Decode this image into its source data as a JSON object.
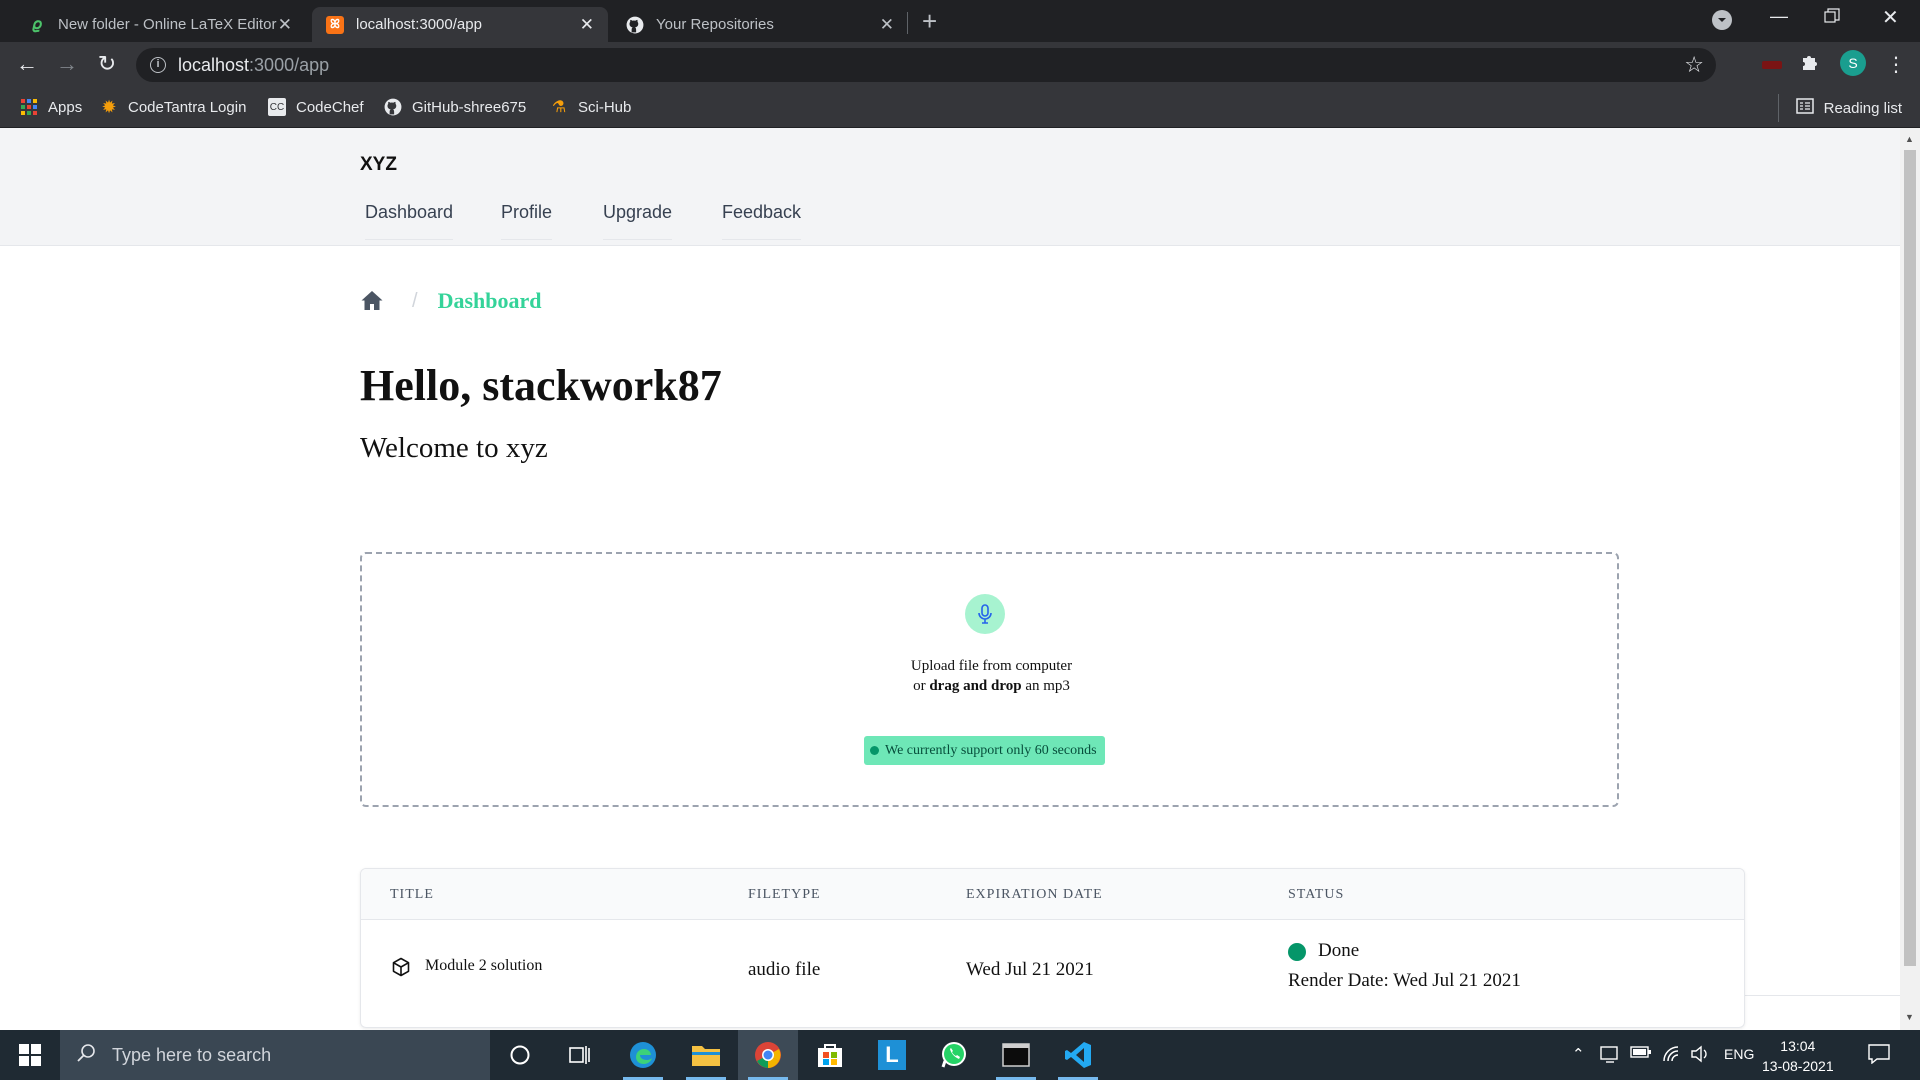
{
  "browser": {
    "tabs": [
      {
        "title": "New folder - Online LaTeX Editor",
        "active": false
      },
      {
        "title": "localhost:3000/app",
        "active": true
      },
      {
        "title": "Your Repositories",
        "active": false
      }
    ],
    "url_host": "localhost",
    "url_path": ":3000/app",
    "profile_initial": "S",
    "bookmarks": [
      "Apps",
      "CodeTantra Login",
      "CodeChef",
      "GitHub-shree675",
      "Sci-Hub"
    ],
    "reading_list": "Reading list"
  },
  "app": {
    "brand": "XYZ",
    "nav": [
      "Dashboard",
      "Profile",
      "Upgrade",
      "Feedback"
    ],
    "breadcrumb": {
      "separator": "/",
      "current": "Dashboard"
    },
    "greeting": "Hello, stackwork87",
    "welcome": "Welcome to xyz",
    "upload": {
      "line1": "Upload file from computer",
      "line2_prefix": "or ",
      "line2_bold": "drag and drop",
      "line2_suffix": " an mp3",
      "badge": "We currently support only 60 seconds"
    },
    "table": {
      "headers": [
        "TITLE",
        "FILETYPE",
        "EXPIRATION DATE",
        "STATUS"
      ],
      "rows": [
        {
          "title": "Module 2 solution",
          "filetype": "audio file",
          "expiration": "Wed Jul 21 2021",
          "status": "Done",
          "render_date": "Render Date: Wed Jul 21 2021"
        }
      ]
    }
  },
  "taskbar": {
    "search_placeholder": "Type here to search",
    "language": "ENG",
    "time": "13:04",
    "date": "13-08-2021"
  },
  "colors": {
    "accent": "#34d399",
    "badge_bg": "#6ee7b7",
    "status_done": "#059669"
  }
}
